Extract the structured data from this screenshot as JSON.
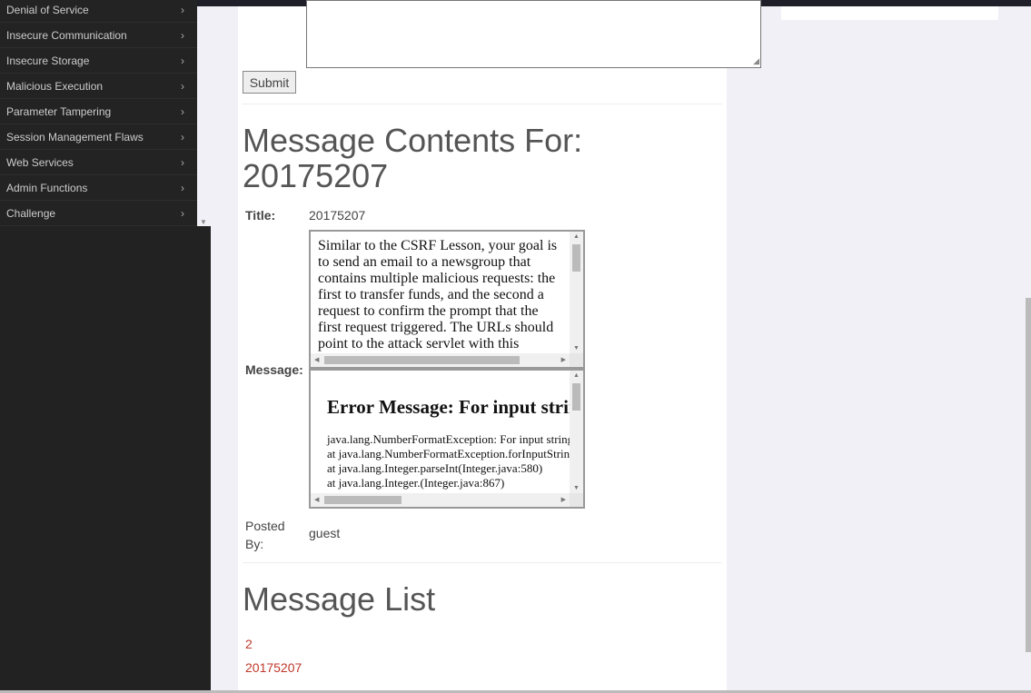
{
  "sidebar": {
    "items": [
      {
        "label": "Denial of Service"
      },
      {
        "label": "Insecure Communication"
      },
      {
        "label": "Insecure Storage"
      },
      {
        "label": "Malicious Execution"
      },
      {
        "label": "Parameter Tampering"
      },
      {
        "label": "Session Management Flaws"
      },
      {
        "label": "Web Services"
      },
      {
        "label": "Admin Functions"
      },
      {
        "label": "Challenge"
      }
    ]
  },
  "form": {
    "submit_label": "Submit"
  },
  "message": {
    "heading": "Message Contents For: 20175207",
    "title_label": "Title:",
    "title_value": "20175207",
    "message_label": "Message:",
    "message_text": "Similar to the CSRF Lesson, your goal is to send an email to a newsgroup that contains multiple malicious requests: the first to transfer funds, and the second a request to confirm the prompt that the first request triggered. The URLs should point to the attack servlet with this",
    "error_heading": "Error Message: For input string",
    "error_lines": [
      "java.lang.NumberFormatException: For input string",
      "at java.lang.NumberFormatException.forInputString",
      "at java.lang.Integer.parseInt(Integer.java:580)",
      "at java.lang.Integer.(Integer.java:867)"
    ],
    "posted_by_label": "Posted By:",
    "posted_by_value": "guest"
  },
  "list": {
    "heading": "Message List",
    "items": [
      "2",
      "20175207"
    ]
  },
  "colors": {
    "sidebar": "#222222",
    "link": "#c0392b",
    "background": "#f0f0f6"
  }
}
